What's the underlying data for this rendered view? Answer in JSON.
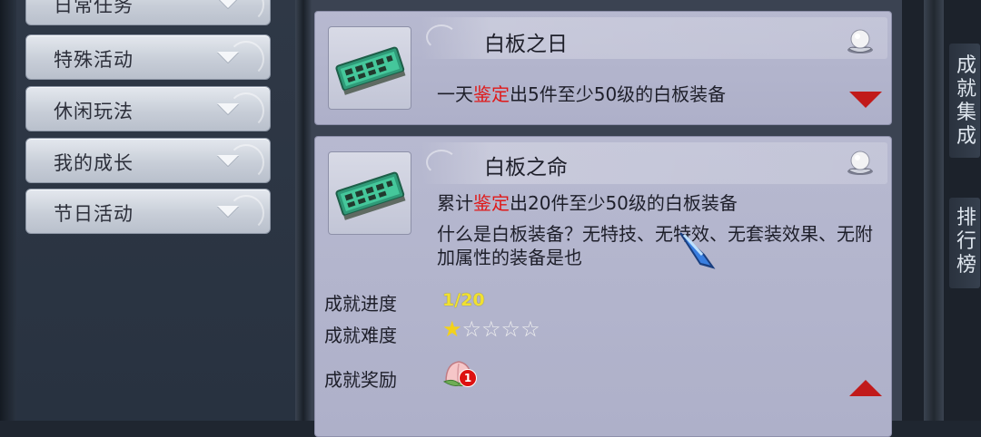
{
  "sidebar": {
    "categories": [
      {
        "label": "日常任务"
      },
      {
        "label": "特殊活动"
      },
      {
        "label": "休闲玩法"
      },
      {
        "label": "我的成长"
      },
      {
        "label": "节日活动"
      }
    ]
  },
  "achievements": [
    {
      "title": "白板之日",
      "desc_prefix": "一天",
      "desc_highlight": "鉴定",
      "desc_suffix": "出5件至少50级的白板装备",
      "expanded": false
    },
    {
      "title": "白板之命",
      "desc_prefix": "累计",
      "desc_highlight": "鉴定",
      "desc_suffix": "出20件至少50级的白板装备",
      "note": "什么是白板装备？无特技、无特效、无套装效果、无附加属性的装备是也",
      "expanded": true,
      "progress_label": "成就进度",
      "progress_value": "1/20",
      "progress_fraction": 0.05,
      "difficulty_label": "成就难度",
      "difficulty_stars": 1,
      "difficulty_max": 5,
      "reward_label": "成就奖励",
      "reward_badge": "1"
    }
  ],
  "rightbar": {
    "tab1": "成就集成",
    "tab2": "排行榜"
  },
  "colors": {
    "highlight": "#e01818",
    "progress": "#f0e030",
    "star_filled": "#f3d21a",
    "arrow": "#c11a1a"
  }
}
